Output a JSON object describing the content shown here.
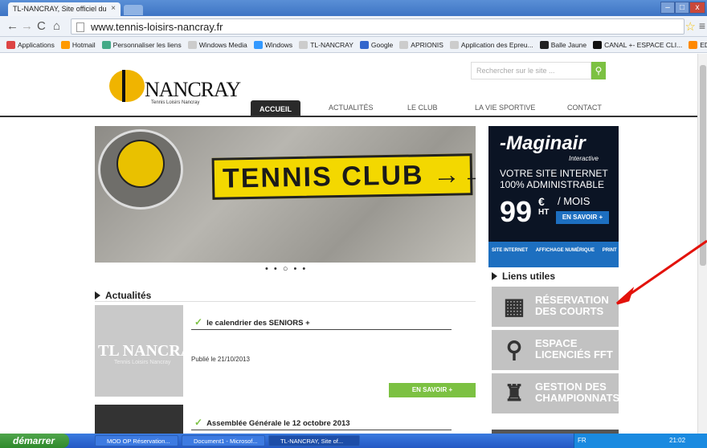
{
  "browser": {
    "tab_title": "TL-NANCRAY, Site officiel du",
    "url": "www.tennis-loisirs-nancray.fr",
    "bookmarks": [
      {
        "label": "Applications",
        "color": "#d44"
      },
      {
        "label": "Hotmail",
        "color": "#f90"
      },
      {
        "label": "Personnaliser les liens",
        "color": "#4a8"
      },
      {
        "label": "Windows Media",
        "color": "#ccc"
      },
      {
        "label": "Windows",
        "color": "#39f"
      },
      {
        "label": "TL-NANCRAY",
        "color": "#ccc"
      },
      {
        "label": "Google",
        "color": "#36c"
      },
      {
        "label": "APRIONIS",
        "color": "#ccc"
      },
      {
        "label": "Application des Epreu...",
        "color": "#ccc"
      },
      {
        "label": "Balle Jaune",
        "color": "#222"
      },
      {
        "label": "CANAL +- ESPACE CLI...",
        "color": "#111"
      },
      {
        "label": "EDF Tempo",
        "color": "#f80"
      }
    ]
  },
  "site": {
    "logo_text": "NANCRAY",
    "logo_sub": "Tennis Loisirs Nancray",
    "search_placeholder": "Rechercher sur le site ...",
    "nav": [
      "ACCUEIL",
      "ACTUALITÉS",
      "LE CLUB",
      "LA VIE SPORTIVE",
      "CONTACT"
    ],
    "hero_sign": "TENNIS CLUB →→",
    "hero_logo": "TENNIS LOISIRS NANCRAY",
    "slider_dots": "• • ○ • •",
    "ad": {
      "brand": "-Maginair",
      "brand_sub": "Interactive",
      "line1": "VOTRE SITE INTERNET",
      "line2": "100% ADMINISTRABLE",
      "price": "99",
      "currency": "€",
      "ht": "HT",
      "per": "/ MOIS",
      "cta": "EN SAVOIR +",
      "footer": [
        "SITE INTERNET",
        "AFFICHAGE NUMÉRIQUE",
        "PRINT"
      ]
    },
    "actualites_title": "Actualités",
    "news": [
      {
        "title": "le calendrier des SENIORS +",
        "date": "Publié le 21/10/2013",
        "cta": "EN SAVOIR +",
        "thumb_title": "TL NANCRAY",
        "thumb_sub": "Tennis Loisirs Nancray"
      },
      {
        "title": "Assemblée Générale le 12 octobre 2013"
      }
    ],
    "liens_title": "Liens utiles",
    "liens": [
      {
        "line1": "RÉSERVATION",
        "line2": "DES COURTS",
        "icon": "court-icon"
      },
      {
        "line1": "ESPACE",
        "line2": "LICENCIÉS FFT",
        "icon": "player-icon"
      },
      {
        "line1": "GESTION DES",
        "line2": "CHAMPIONNATS",
        "icon": "trophy-icon"
      }
    ]
  },
  "taskbar": {
    "start": "démarrer",
    "tasks": [
      "MOD OP Réservation...",
      "Document1 - Microsof...",
      "TL-NANCRAY, Site of..."
    ],
    "lang": "FR",
    "time": "21:02"
  },
  "annotation_color": "#e3120b"
}
